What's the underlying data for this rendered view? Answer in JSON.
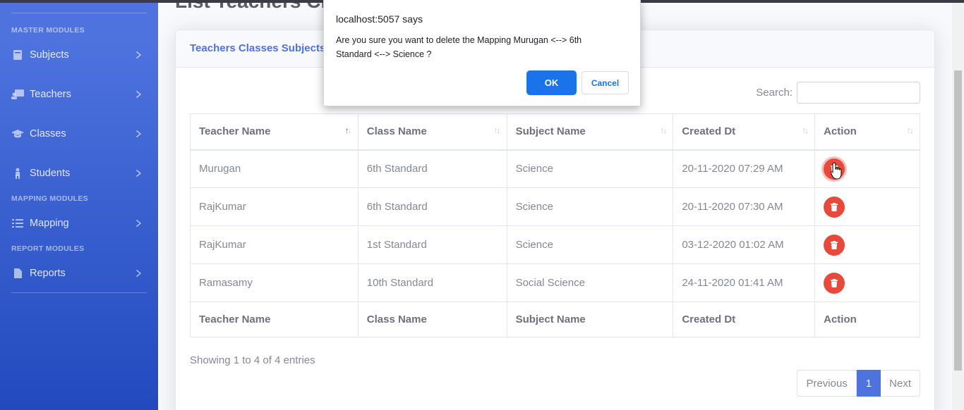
{
  "sidebar": {
    "headings": {
      "master": "MASTER MODULES",
      "mapping": "MAPPING MODULES",
      "report": "REPORT MODULES"
    },
    "items": [
      {
        "label": "Subjects",
        "icon": "book-icon"
      },
      {
        "label": "Teachers",
        "icon": "chalkboard-teacher-icon"
      },
      {
        "label": "Classes",
        "icon": "graduation-cap-icon"
      },
      {
        "label": "Students",
        "icon": "child-icon"
      },
      {
        "label": "Mapping",
        "icon": "list-check-icon"
      },
      {
        "label": "Reports",
        "icon": "file-icon"
      }
    ]
  },
  "main": {
    "page_title": "List Teachers Classes Subjects",
    "card_title": "Teachers Classes Subjects",
    "search_label": "Search:",
    "columns": [
      "Teacher Name",
      "Class Name",
      "Subject Name",
      "Created Dt",
      "Action"
    ],
    "rows": [
      {
        "teacher": "Murugan",
        "class": "6th Standard",
        "subject": "Science",
        "created": "20-11-2020 07:29 AM"
      },
      {
        "teacher": "RajKumar",
        "class": "6th Standard",
        "subject": "Science",
        "created": "20-11-2020 07:30 AM"
      },
      {
        "teacher": "RajKumar",
        "class": "1st Standard",
        "subject": "Science",
        "created": "03-12-2020 01:02 AM"
      },
      {
        "teacher": "Ramasamy",
        "class": "10th Standard",
        "subject": "Social Science",
        "created": "24-11-2020 01:41 AM"
      }
    ],
    "info": "Showing 1 to 4 of 4 entries",
    "pagination": {
      "previous": "Previous",
      "page": "1",
      "next": "Next"
    }
  },
  "dialog": {
    "title": "localhost:5057 says",
    "message": "Are you sure you want to delete the Mapping Murugan <--> 6th Standard <--> Science ?",
    "ok": "OK",
    "cancel": "Cancel"
  },
  "colors": {
    "sidebar": "#4e73df",
    "danger": "#e74a3b",
    "dialog_primary": "#1a73e8"
  }
}
